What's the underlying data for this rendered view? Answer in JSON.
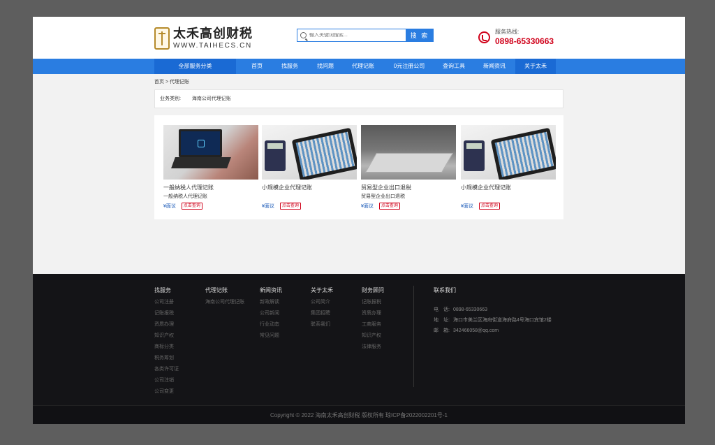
{
  "header": {
    "logo_cn": "太禾高创财税",
    "logo_en": "WWW.TAIHECS.CN",
    "search_placeholder": "输入关键词搜索...",
    "search_button": "搜 索",
    "hotline_label": "服务热线:",
    "hotline_number": "0898-65330663"
  },
  "nav": {
    "all_services": "全部服务分类",
    "items": [
      "首页",
      "找服务",
      "找问题",
      "代理记账",
      "0元注册公司",
      "查询工具",
      "新闻资讯",
      "关于太禾"
    ]
  },
  "breadcrumb": "首页 > 代理记账",
  "filter": {
    "label": "业务类别:",
    "value": "海南公司代理记账"
  },
  "products": [
    {
      "title": "一般纳税人代理记账",
      "subtitle": "一般纳税人代理记账",
      "price": "¥面议",
      "detail": "点击查询"
    },
    {
      "title": "小规模企业代理记账",
      "subtitle": "",
      "price": "¥面议",
      "detail": "点击查询"
    },
    {
      "title": "贸易型企业出口退税",
      "subtitle": "贸易型企业出口退税",
      "price": "¥面议",
      "detail": "点击查询"
    },
    {
      "title": "小规模企业代理记账",
      "subtitle": "",
      "price": "¥面议",
      "detail": "点击查询"
    }
  ],
  "footer": {
    "columns": [
      {
        "title": "找服务",
        "links": [
          "公司注册",
          "记账报税",
          "资质办理",
          "知识产权",
          "商标分类",
          "税务筹划",
          "各类许可证",
          "公司注销",
          "公司变更"
        ]
      },
      {
        "title": "代理记账",
        "links": [
          "海南公司代理记账"
        ]
      },
      {
        "title": "新闻资讯",
        "links": [
          "新政解读",
          "公司新闻",
          "行业动态",
          "常见问题"
        ]
      },
      {
        "title": "关于太禾",
        "links": [
          "公司简介",
          "集团招聘",
          "联系我们"
        ]
      },
      {
        "title": "财务顾问",
        "links": [
          "记账报税",
          "资质办理",
          "工商服务",
          "知识产权",
          "法律服务"
        ]
      }
    ],
    "contact": {
      "title": "联系我们",
      "phone_label": "电　话:",
      "phone": "0898-65330663",
      "address_label": "地　址:",
      "address": "海口市美兰区海府街道海府路4号海口宾馆2楼",
      "email_label": "邮　箱:",
      "email": "342466058@qq.com"
    },
    "copyright": "Copyright © 2022 海南太禾高创财税 版权所有 琼ICP备2022002201号-1"
  },
  "colors": {
    "primary": "#2a7de1",
    "accent_red": "#d0021b",
    "footer_bg": "#141417",
    "logo_gold": "#b58a2a"
  }
}
